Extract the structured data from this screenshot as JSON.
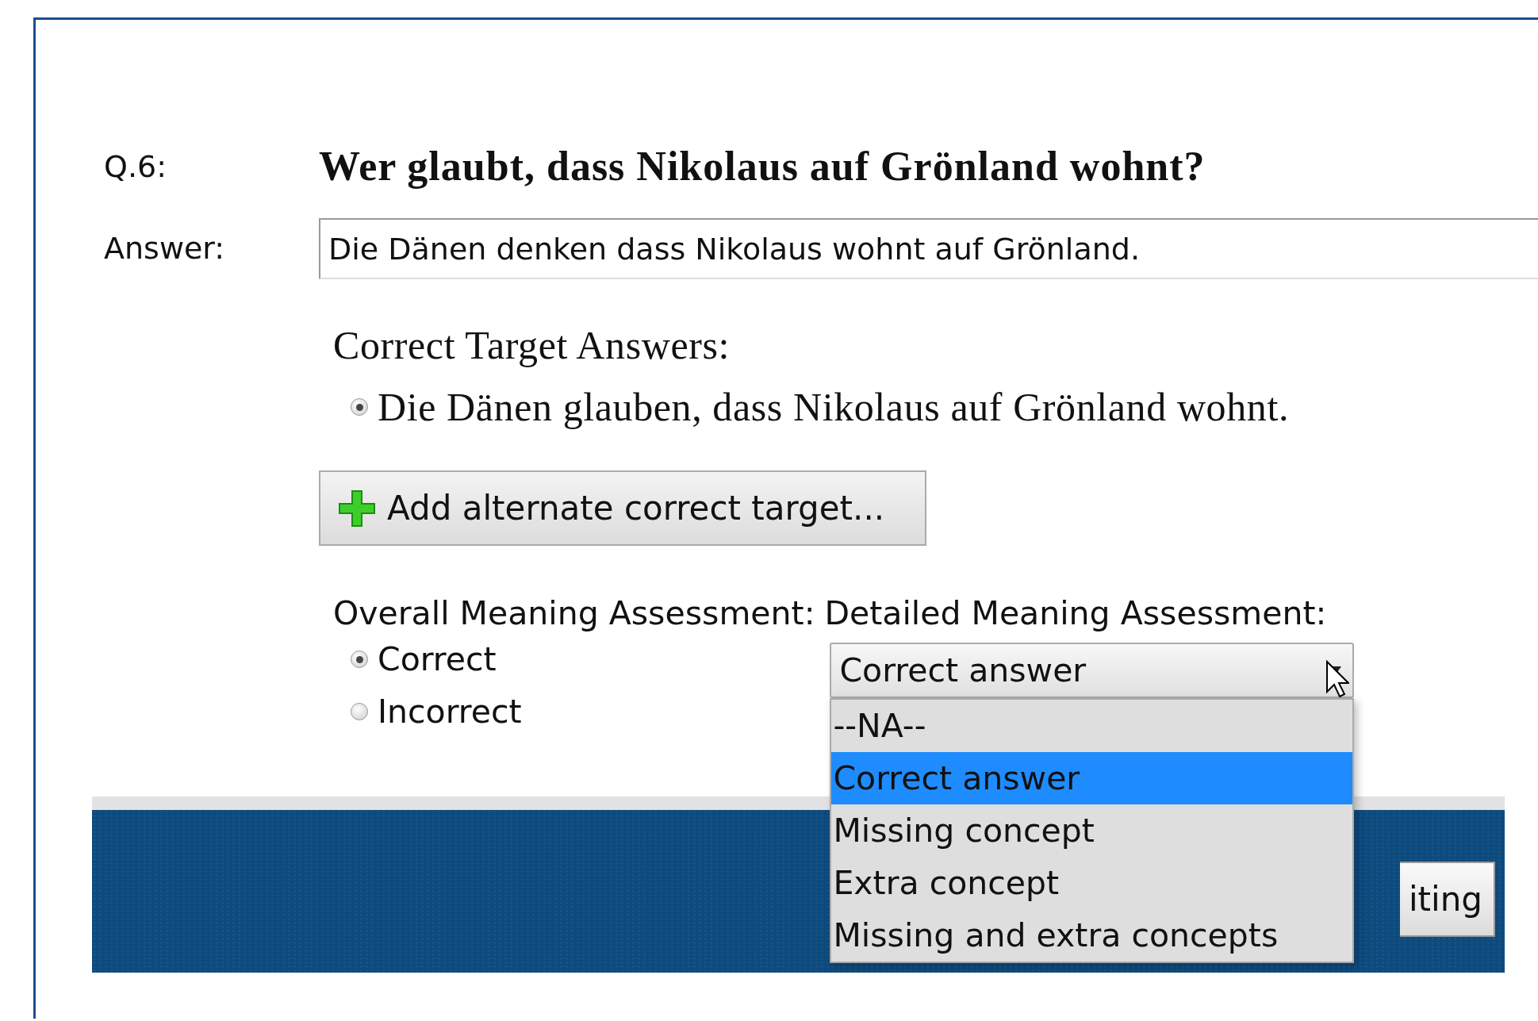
{
  "question": {
    "number": "Q.6:",
    "text": "Wer glaubt, dass Nikolaus auf Grönland wohnt?"
  },
  "answer": {
    "label": "Answer:",
    "value": "Die Dänen denken dass Nikolaus wohnt auf Grönland."
  },
  "targets": {
    "heading": "Correct Target Answers:",
    "items": [
      {
        "text": "Die Dänen glauben, dass Nikolaus auf Grönland wohnt.",
        "selected": true
      }
    ]
  },
  "add_button": "Add alternate correct target...",
  "overall": {
    "label": "Overall Meaning Assessment:",
    "options": [
      {
        "label": "Correct",
        "selected": true
      },
      {
        "label": "Incorrect",
        "selected": false
      }
    ]
  },
  "detailed": {
    "label": "Detailed Meaning Assessment:",
    "value": "Correct answer",
    "expanded": true,
    "options": [
      {
        "label": "--NA--",
        "selected": false
      },
      {
        "label": "Correct answer",
        "selected": true
      },
      {
        "label": "Missing concept",
        "selected": false
      },
      {
        "label": "Extra concept",
        "selected": false
      },
      {
        "label": "Missing and extra concepts",
        "selected": false
      }
    ]
  },
  "footer": {
    "button": "iting"
  }
}
